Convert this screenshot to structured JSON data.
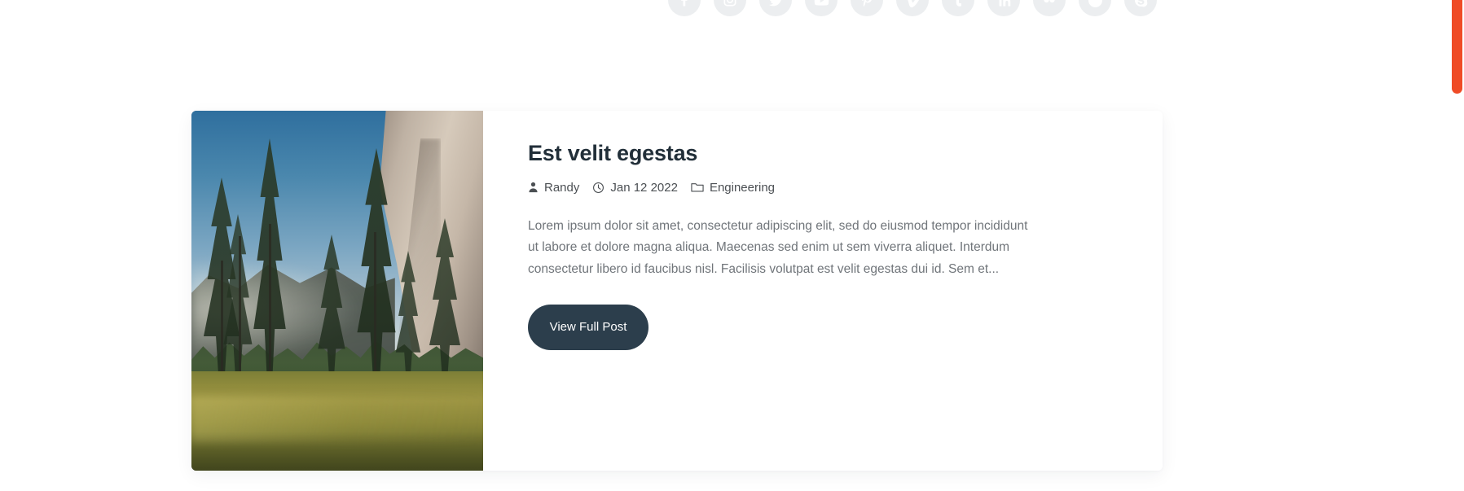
{
  "page": {
    "background_color": "#ffffff"
  },
  "social_bar": {
    "items": [
      {
        "name": "facebook",
        "label": "Facebook"
      },
      {
        "name": "instagram",
        "label": "Instagram"
      },
      {
        "name": "twitter",
        "label": "Twitter"
      },
      {
        "name": "youtube",
        "label": "YouTube"
      },
      {
        "name": "pinterest",
        "label": "Pinterest"
      },
      {
        "name": "vimeo",
        "label": "Vimeo"
      },
      {
        "name": "tumblr",
        "label": "Tumblr"
      },
      {
        "name": "linkedin",
        "label": "LinkedIn"
      },
      {
        "name": "flickr",
        "label": "Flickr"
      },
      {
        "name": "dribbble",
        "label": "Dribbble"
      },
      {
        "name": "skype",
        "label": "Skype"
      }
    ],
    "icon_background_color": "#eceef0",
    "icon_glyph_color": "#ffffff"
  },
  "scrollbar": {
    "thumb_color": "#ef4b26",
    "track_color": "#ffffff"
  },
  "post_card": {
    "thumbnail": {
      "alt": "Yosemite valley with pine trees, granite cliff and sunlit meadow"
    },
    "title": "Est velit egestas",
    "meta": {
      "author_icon": "user-icon",
      "author": "Randy",
      "date_icon": "clock-icon",
      "date": "Jan 12 2022",
      "category_icon": "folder-icon",
      "category": "Engineering"
    },
    "excerpt": "Lorem ipsum dolor sit amet, consectetur adipiscing elit, sed do eiusmod tempor incididunt ut labore et dolore magna aliqua. Maecenas sed enim ut sem viverra aliquet. Interdum consectetur libero id faucibus nisl. Facilisis volutpat est velit egestas dui id. Sem et...",
    "button": {
      "label": "View Full Post",
      "background_color": "#2c3e4c",
      "text_color": "#ffffff"
    }
  }
}
